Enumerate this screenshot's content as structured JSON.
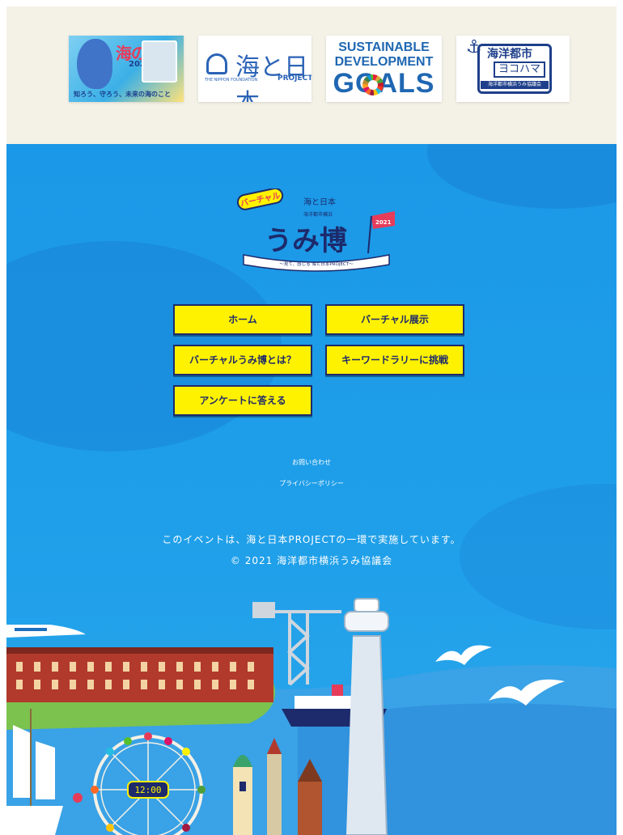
{
  "sponsors": {
    "umi_no_hi": {
      "title": "海の日",
      "year": "2021",
      "caption": "知ろう、守ろう、未来の海のこと"
    },
    "nippon_foundation": {
      "foundation_text": "THE NIPPON FOUNDATION",
      "umi_to_nihon": "海と日本",
      "project": "PROJECT"
    },
    "sdgs": {
      "line1": "SUSTAINABLE",
      "line2": "DEVELOPMENT",
      "line3": "GOALS"
    },
    "yokohama": {
      "line1": "海洋都市",
      "line2": "ヨコハマ",
      "line3": "海洋都市横浜うみ協議会"
    }
  },
  "logo": {
    "badge": "バーチャル",
    "organizer": "海洋都市横浜",
    "title": "うみ博",
    "year": "2021",
    "ribbon": "〜見て、感じる 海と日本PROJECT〜",
    "project_mark": "海と日本"
  },
  "nav": {
    "home": "ホーム",
    "virtual_exhibit": "バーチャル展示",
    "about": "バーチャルうみ博とは？",
    "keyword_rally": "キーワードラリーに挑戦",
    "survey": "アンケートに答える"
  },
  "footer": {
    "contact": "お問い合わせ",
    "privacy": "プライバシーポリシー",
    "notice": "このイベントは、海と日本PROJECTの一環で実施しています。",
    "copyright": "© 2021 海洋都市横浜うみ協議会"
  },
  "scene": {
    "ferris_wheel_clock": "12:00"
  },
  "colors": {
    "ocean": "#1f9fe9",
    "button_bg": "#fff200",
    "button_border": "#1d2a6b",
    "sponsor_strip": "#f4f1e6"
  }
}
